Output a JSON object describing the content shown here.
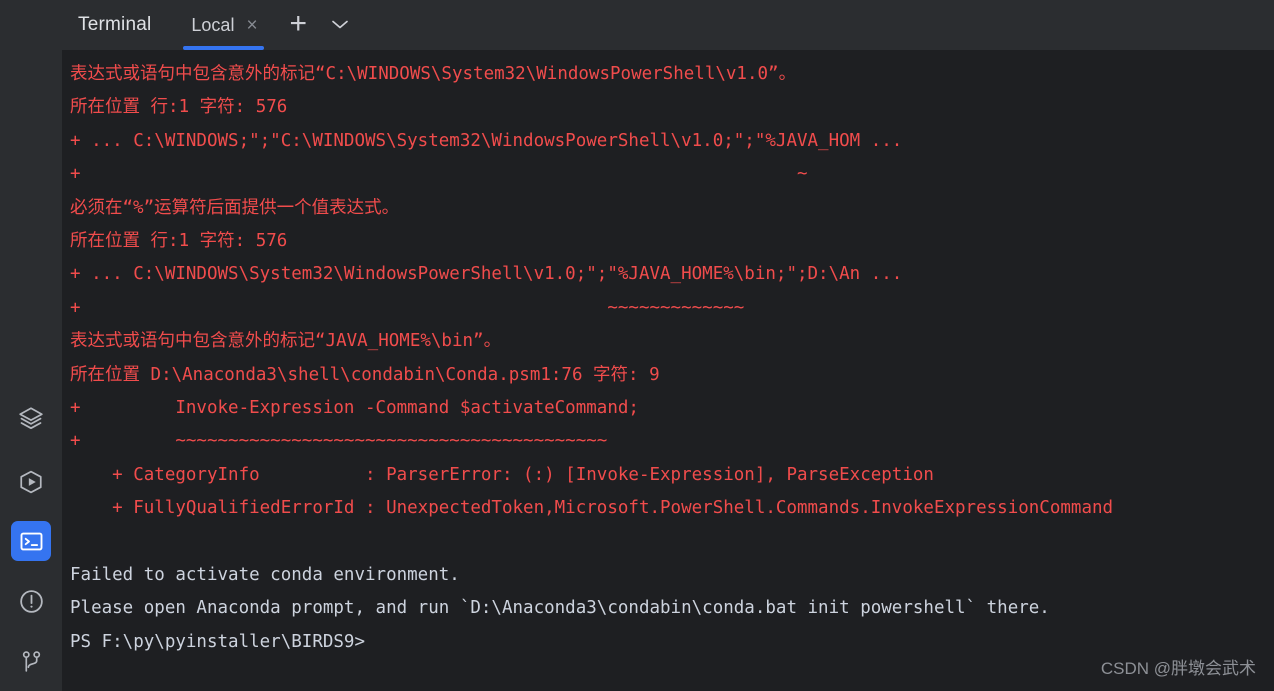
{
  "window": {
    "background_color": "#1e1f22",
    "chrome_color": "#2b2d30",
    "accent_color": "#3574f0",
    "error_text_color": "#f14c4c",
    "output_text_color": "#cdd3de"
  },
  "sidebar": {
    "items": [
      {
        "name": "services-tool-window",
        "icon": "layers-icon",
        "label": "Services",
        "active": false
      },
      {
        "name": "run-tool-window",
        "icon": "run-icon",
        "label": "Run",
        "active": false
      },
      {
        "name": "terminal-tool-window",
        "icon": "terminal-icon",
        "label": "Terminal",
        "active": true
      },
      {
        "name": "problems-tool-window",
        "icon": "problems-icon",
        "label": "Problems",
        "active": false
      },
      {
        "name": "version-control-window",
        "icon": "git-branch-icon",
        "label": "Git",
        "active": false
      }
    ]
  },
  "toolwindow": {
    "title": "Terminal",
    "tab": {
      "label": "Local",
      "close_label": "×",
      "add_label": "+",
      "dropdown_label": "⌄"
    }
  },
  "console": {
    "lines": [
      {
        "type": "error",
        "text": "表达式或语句中包含意外的标记“C:\\WINDOWS\\System32\\WindowsPowerShell\\v1.0”。"
      },
      {
        "type": "error",
        "text": "所在位置 行:1 字符: 576"
      },
      {
        "type": "error",
        "text": "+ ... C:\\WINDOWS;\";\"C:\\WINDOWS\\System32\\WindowsPowerShell\\v1.0;\";\"%JAVA_HOM ..."
      },
      {
        "type": "error",
        "text": "+                                                                    ~"
      },
      {
        "type": "error",
        "text": "必须在“%”运算符后面提供一个值表达式。"
      },
      {
        "type": "error",
        "text": "所在位置 行:1 字符: 576"
      },
      {
        "type": "error",
        "text": "+ ... C:\\WINDOWS\\System32\\WindowsPowerShell\\v1.0;\";\"%JAVA_HOME%\\bin;\";D:\\An ..."
      },
      {
        "type": "error",
        "text": "+                                                  ~~~~~~~~~~~~~"
      },
      {
        "type": "error",
        "text": "表达式或语句中包含意外的标记“JAVA_HOME%\\bin”。"
      },
      {
        "type": "error",
        "text": "所在位置 D:\\Anaconda3\\shell\\condabin\\Conda.psm1:76 字符: 9"
      },
      {
        "type": "error",
        "text": "+         Invoke-Expression -Command $activateCommand;"
      },
      {
        "type": "error",
        "text": "+         ~~~~~~~~~~~~~~~~~~~~~~~~~~~~~~~~~~~~~~~~~"
      },
      {
        "type": "error",
        "text": "    + CategoryInfo          : ParserError: (:) [Invoke-Expression], ParseException"
      },
      {
        "type": "error",
        "text": "    + FullyQualifiedErrorId : UnexpectedToken,Microsoft.PowerShell.Commands.InvokeExpressionCommand"
      },
      {
        "type": "blank",
        "text": " "
      },
      {
        "type": "output",
        "text": "Failed to activate conda environment."
      },
      {
        "type": "output",
        "text": "Please open Anaconda prompt, and run `D:\\Anaconda3\\condabin\\conda.bat init powershell` there."
      },
      {
        "type": "output",
        "text": "PS F:\\py\\pyinstaller\\BIRDS9>"
      }
    ]
  },
  "watermark": {
    "text": "CSDN @胖墩会武术"
  }
}
